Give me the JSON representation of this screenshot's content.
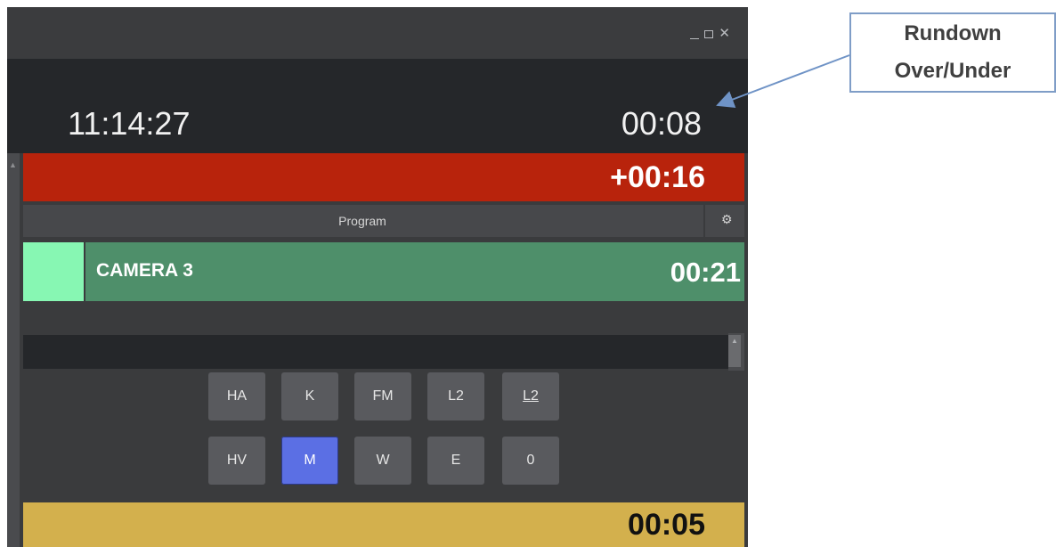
{
  "window": {
    "controls": [
      "_",
      "□",
      "✕"
    ]
  },
  "clock": {
    "time": "11:14:27",
    "over_under": "00:08"
  },
  "status": {
    "delta": "+00:16"
  },
  "program": {
    "label": "Program",
    "gear_icon": "gear-icon"
  },
  "current_item": {
    "name": "CAMERA 3",
    "duration": "00:21",
    "swatch_color": "#87f7b3"
  },
  "buttons": {
    "row1": [
      "HA",
      "K",
      "FM",
      "L2",
      "L2"
    ],
    "row2": [
      "HV",
      "M",
      "W",
      "E",
      "0"
    ],
    "active": "M"
  },
  "footer": {
    "countdown": "00:05"
  },
  "callout": {
    "line1": "Rundown",
    "line2": "Over/Under"
  },
  "colors": {
    "red_bar": "#b8230c",
    "green_row": "#4e8f6a",
    "yellow_bar": "#d3b04d",
    "active_button": "#5b6fe4"
  }
}
